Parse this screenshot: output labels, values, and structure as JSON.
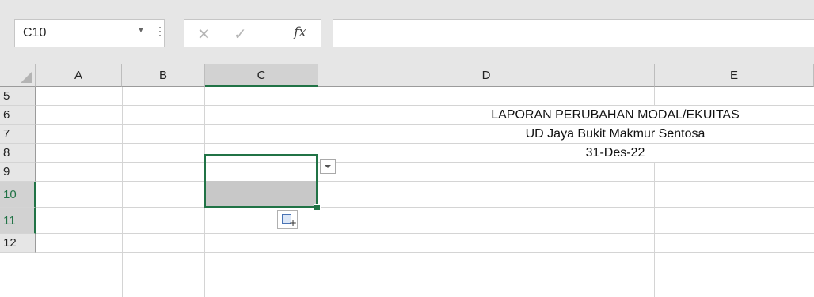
{
  "name_box": {
    "value": "C10"
  },
  "formula_bar": {
    "cancel_symbol": "✕",
    "enter_symbol": "✓",
    "fx_symbol": "fx",
    "value": ""
  },
  "columns": [
    "A",
    "B",
    "C",
    "D",
    "E"
  ],
  "selected_column": "C",
  "rows": [
    "5",
    "6",
    "7",
    "8",
    "9",
    "10",
    "11",
    "12"
  ],
  "selected_rows": [
    "10",
    "11"
  ],
  "cells": {
    "D6": "LAPORAN PERUBAHAN MODAL/EKUITAS",
    "D7": "UD Jaya Bukit Makmur Sentosa",
    "D8": "31-Des-22"
  },
  "colors": {
    "accent": "#217346",
    "header_bg": "#e6e6e6",
    "selected_header_bg": "#d2d2d2"
  }
}
